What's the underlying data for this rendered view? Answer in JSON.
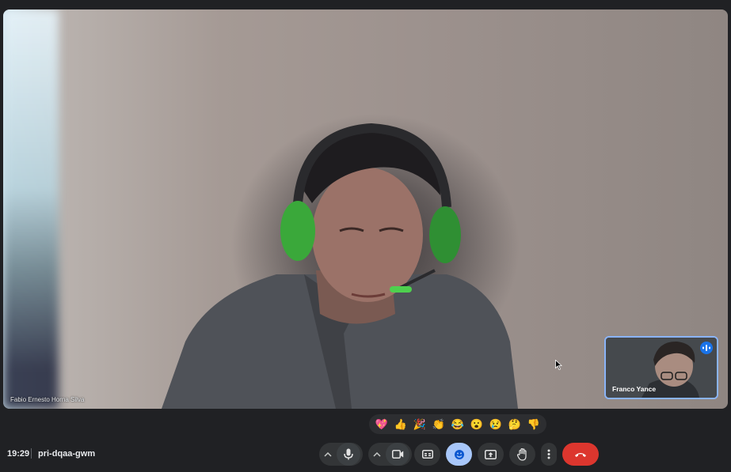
{
  "main_video": {
    "participant_name": "Fabio Ernesto Horna Silva"
  },
  "pip": {
    "participant_name": "Franco Yance"
  },
  "reactions": [
    "💖",
    "👍",
    "🎉",
    "👏",
    "😂",
    "😮",
    "😢",
    "🤔",
    "👎"
  ],
  "footer": {
    "time": "19:29",
    "meeting_code": "pri-dqaa-gwm"
  },
  "colors": {
    "end_call": "#dc362e",
    "active_button": "#a8c7fa",
    "speaking": "#1a73e8"
  }
}
